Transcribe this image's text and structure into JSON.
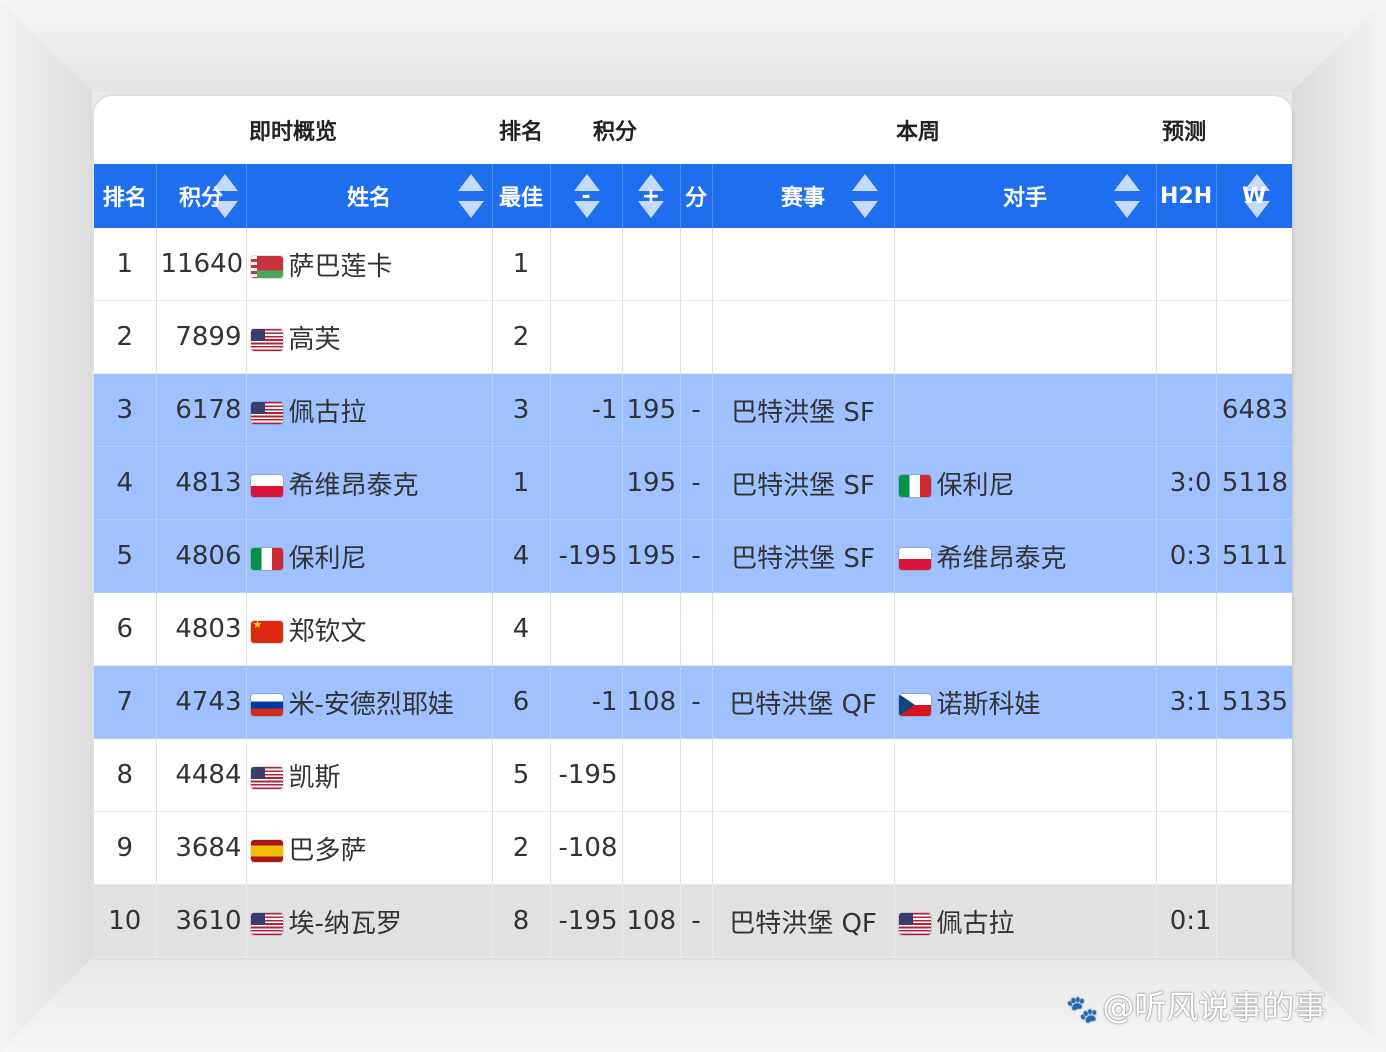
{
  "groups": {
    "overview": "即时概览",
    "rank": "排名",
    "points": "积分",
    "this_week": "本周",
    "forecast": "预测"
  },
  "columns": {
    "rank": "排名",
    "points": "积分",
    "name": "姓名",
    "best": "最佳",
    "minus": "-",
    "plus": "+",
    "pts": "分",
    "event": "赛事",
    "opponent": "对手",
    "h2h": "H2H",
    "w": "W"
  },
  "rows": [
    {
      "rank": "1",
      "points": "11640",
      "flag": "belarus-flag-icon",
      "name": "萨巴莲卡",
      "best": "1",
      "minus": "",
      "plus": "",
      "pts": "",
      "event": "",
      "opp_flag": "",
      "opponent": "",
      "h2h": "",
      "w": "",
      "style": "white"
    },
    {
      "rank": "2",
      "points": "7899",
      "flag": "usa-flag-icon",
      "name": "高芙",
      "best": "2",
      "minus": "",
      "plus": "",
      "pts": "",
      "event": "",
      "opp_flag": "",
      "opponent": "",
      "h2h": "",
      "w": "",
      "style": "white"
    },
    {
      "rank": "3",
      "points": "6178",
      "flag": "usa-flag-icon",
      "name": "佩古拉",
      "best": "3",
      "minus": "-1",
      "plus": "195",
      "pts": "-",
      "event": "巴特洪堡 SF",
      "opp_flag": "",
      "opponent": "",
      "h2h": "",
      "w": "6483",
      "style": "hl"
    },
    {
      "rank": "4",
      "points": "4813",
      "flag": "poland-flag-icon",
      "name": "希维昂泰克",
      "best": "1",
      "minus": "",
      "plus": "195",
      "pts": "-",
      "event": "巴特洪堡 SF",
      "opp_flag": "italy-flag-icon",
      "opponent": "保利尼",
      "h2h": "3:0",
      "w": "5118",
      "style": "hl"
    },
    {
      "rank": "5",
      "points": "4806",
      "flag": "italy-flag-icon",
      "name": "保利尼",
      "best": "4",
      "minus": "-195",
      "plus": "195",
      "pts": "-",
      "event": "巴特洪堡 SF",
      "opp_flag": "poland-flag-icon",
      "opponent": "希维昂泰克",
      "h2h": "0:3",
      "w": "5111",
      "style": "hl"
    },
    {
      "rank": "6",
      "points": "4803",
      "flag": "china-flag-icon",
      "name": "郑钦文",
      "best": "4",
      "minus": "",
      "plus": "",
      "pts": "",
      "event": "",
      "opp_flag": "",
      "opponent": "",
      "h2h": "",
      "w": "",
      "style": "white"
    },
    {
      "rank": "7",
      "points": "4743",
      "flag": "russia-flag-icon",
      "name": "米-安德烈耶娃",
      "best": "6",
      "minus": "-1",
      "plus": "108",
      "pts": "-",
      "event": "巴特洪堡 QF",
      "opp_flag": "czech-flag-icon",
      "opponent": "诺斯科娃",
      "h2h": "3:1",
      "w": "5135",
      "style": "hl"
    },
    {
      "rank": "8",
      "points": "4484",
      "flag": "usa-flag-icon",
      "name": "凯斯",
      "best": "5",
      "minus": "-195",
      "plus": "",
      "pts": "",
      "event": "",
      "opp_flag": "",
      "opponent": "",
      "h2h": "",
      "w": "",
      "style": "white"
    },
    {
      "rank": "9",
      "points": "3684",
      "flag": "spain-flag-icon",
      "name": "巴多萨",
      "best": "2",
      "minus": "-108",
      "plus": "",
      "pts": "",
      "event": "",
      "opp_flag": "",
      "opponent": "",
      "h2h": "",
      "w": "",
      "style": "white"
    },
    {
      "rank": "10",
      "points": "3610",
      "flag": "usa-flag-icon",
      "name": "埃-纳瓦罗",
      "best": "8",
      "minus": "-195",
      "plus": "108",
      "pts": "-",
      "event": "巴特洪堡 QF",
      "opp_flag": "usa-flag-icon",
      "opponent": "佩古拉",
      "h2h": "0:1",
      "w": "",
      "style": "grey"
    }
  ],
  "watermark": "@听风说事的事",
  "colors": {
    "header_blue": "#1f6ef0",
    "highlight_blue": "#9fc1ff",
    "grey_row": "#e1e1e1"
  }
}
